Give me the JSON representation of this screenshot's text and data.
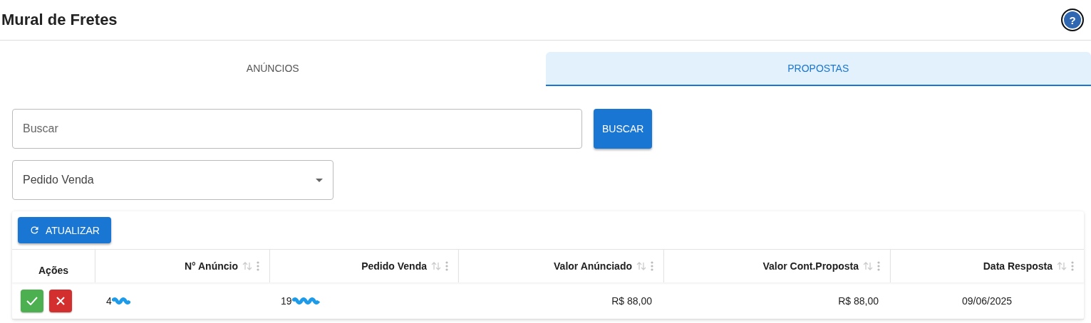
{
  "header": {
    "title": "Mural de Fretes",
    "help": "?"
  },
  "tabs": [
    {
      "label": "ANÚNCIOS",
      "selected": false
    },
    {
      "label": "PROPOSTAS",
      "selected": true
    }
  ],
  "search": {
    "placeholder": "Buscar",
    "button": "BUSCAR"
  },
  "filter": {
    "value": "Pedido Venda"
  },
  "table": {
    "refresh": "ATUALIZAR",
    "actions_column": "Ações",
    "columns": [
      "N° Anúncio",
      "Pedido Venda",
      "Valor Anúnciado",
      "Valor Cont.Proposta",
      "Data Resposta"
    ],
    "rows": [
      {
        "cells": [
          "4",
          "19",
          "R$ 88,00",
          "R$ 88,00",
          "09/06/2025"
        ]
      }
    ]
  }
}
